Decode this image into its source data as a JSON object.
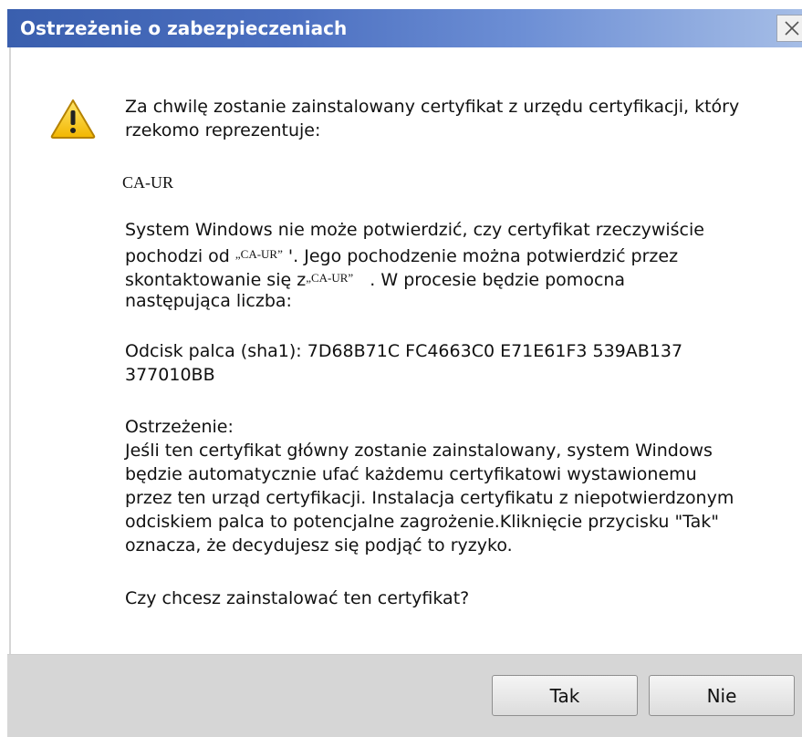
{
  "window": {
    "title": "Ostrzeżenie o zabezpieczeniach"
  },
  "icons": {
    "warning": "warning-icon",
    "close": "close-icon"
  },
  "message": {
    "intro_line1": "Za chwilę zostanie zainstalowany certyfikat z urzędu certyfikacji, który",
    "intro_line2": "rzekomo reprezentuje:",
    "ca_name": "CA-UR",
    "verify_line1": "System Windows nie może potwierdzić, czy certyfikat rzeczywiście",
    "verify_line2_a": "pochodzi od ",
    "verify_line2_ca": "„CA-UR”",
    "verify_line2_b": " '. Jego pochodzenie można potwierdzić przez",
    "verify_line3_a": "skontaktowanie się z",
    "verify_line3_ca": "„CA-UR”",
    "verify_line3_b": "   . W procesie będzie pomocna",
    "verify_line4": "następująca liczba:",
    "thumbprint_line1": "Odcisk palca (sha1): 7D68B71C FC4663C0 E71E61F3 539AB137",
    "thumbprint_line2": "377010BB",
    "warning_heading": "Ostrzeżenie:",
    "warning_line1": "Jeśli ten certyfikat główny zostanie zainstalowany, system Windows",
    "warning_line2": "będzie automatycznie ufać każdemu certyfikatowi wystawionemu",
    "warning_line3": "przez ten urząd certyfikacji. Instalacja certyfikatu z niepotwierdzonym",
    "warning_line4": "odciskiem palca to potencjalne zagrożenie.Kliknięcie przycisku \"Tak\"",
    "warning_line5": "oznacza, że decydujesz się podjąć to ryzyko.",
    "question": "Czy chcesz zainstalować ten certyfikat?"
  },
  "buttons": {
    "yes": "Tak",
    "no": "Nie"
  }
}
